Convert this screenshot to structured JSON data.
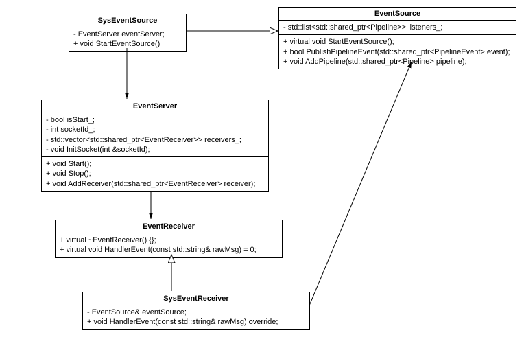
{
  "classes": {
    "sysEventSource": {
      "name": "SysEventSource",
      "members": [
        "- EventServer eventServer;",
        "+ void StartEventSource()"
      ]
    },
    "eventSource": {
      "name": "EventSource",
      "members": [
        "- std::list<std::shared_ptr<Pipeline>> listeners_;"
      ],
      "methods": [
        "+ virtual void StartEventSource();",
        "+ bool PublishPipelineEvent(std::shared_ptr<PipelineEvent> event);",
        "+ void AddPipeline(std::shared_ptr<Pipeline> pipeline);"
      ]
    },
    "eventServer": {
      "name": "EventServer",
      "members": [
        "- bool isStart_;",
        "- int socketId_;",
        "- std::vector<std::shared_ptr<EventReceiver>> receivers_;",
        "- void InitSocket(int &socketId);"
      ],
      "methods": [
        "+ void Start();",
        "+ void Stop();",
        "+ void AddReceiver(std::shared_ptr<EventReceiver> receiver);"
      ]
    },
    "eventReceiver": {
      "name": "EventReceiver",
      "methods": [
        "+ virtual ~EventReceiver() {};",
        "+ virtual void HandlerEvent(const std::string& rawMsg) = 0;"
      ]
    },
    "sysEventReceiver": {
      "name": "SysEventReceiver",
      "members": [
        "- EventSource& eventSource;",
        "+ void HandlerEvent(const std::string& rawMsg) override;"
      ]
    }
  }
}
